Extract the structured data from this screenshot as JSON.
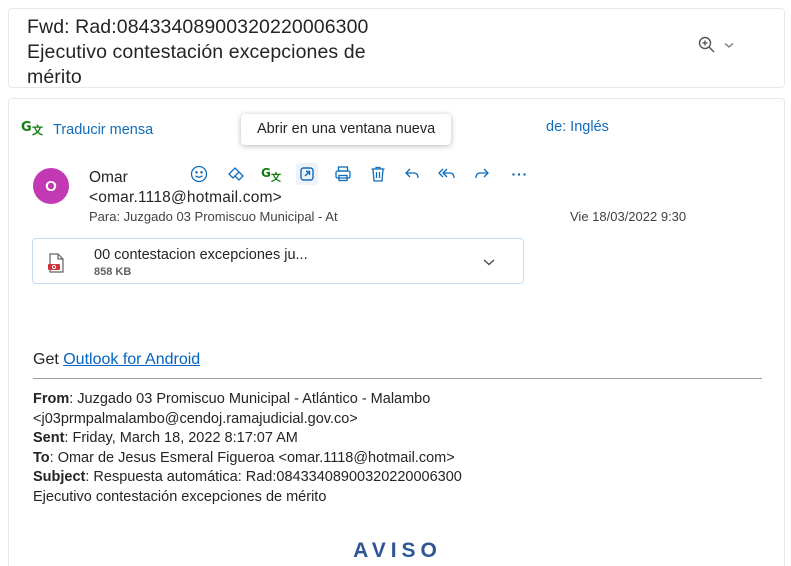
{
  "subject": {
    "lines": [
      "Fwd: Rad:08433408900320220006300",
      "Ejecutivo contestación excepciones de",
      "mérito"
    ]
  },
  "zoom": {
    "icon": "zoom-in-icon",
    "chevron": "chevron-down-icon"
  },
  "translate": {
    "icon": "translate-icon",
    "label": "Traducir mensa",
    "tail": "de: Inglés"
  },
  "tooltip": "Abrir en una ventana nueva",
  "sender": {
    "initial": "O",
    "avatar_color": "#c239b3",
    "name": "Omar",
    "email": "<omar.1118@hotmail.com>",
    "to": "Para:  Juzgado 03 Promiscuo Municipal - At",
    "date": "Vie 18/03/2022 9:30"
  },
  "toolbar": [
    {
      "name": "emoji-icon",
      "label": "Reaccionar"
    },
    {
      "name": "immersive-reader-icon",
      "label": "Lector inmersivo"
    },
    {
      "name": "translate-icon",
      "label": "Traducir"
    },
    {
      "name": "open-new-window-icon",
      "label": "Abrir en una ventana nueva"
    },
    {
      "name": "print-icon",
      "label": "Imprimir"
    },
    {
      "name": "delete-icon",
      "label": "Eliminar"
    },
    {
      "name": "reply-icon",
      "label": "Responder"
    },
    {
      "name": "reply-all-icon",
      "label": "Responder a todos"
    },
    {
      "name": "forward-icon",
      "label": "Reenviar"
    },
    {
      "name": "more-icon",
      "label": "Más acciones"
    }
  ],
  "attachment": {
    "icon": "pdf-file-icon",
    "name": "00 contestacion excepciones ju...",
    "size": "858 KB"
  },
  "body": {
    "get_prefix": "Get ",
    "get_link": "Outlook for Android",
    "from_label": "From",
    "from_value": ": Juzgado 03 Promiscuo Municipal - Atlántico - Malambo",
    "from_email": "<j03prmpalmalambo@cendoj.ramajudicial.gov.co>",
    "sent_label": "Sent",
    "sent_value": ": Friday, March 18, 2022 8:17:07 AM",
    "to_label": "To",
    "to_value": ": Omar de Jesus Esmeral Figueroa <omar.1118@hotmail.com>",
    "subject_label": "Subject",
    "subject_value": ": Respuesta automática: Rad:08433408900320220006300",
    "subject_cont": "Ejecutivo contestación excepciones de mérito",
    "aviso": "AVISO"
  },
  "colors": {
    "accent": "#0f6cbd",
    "link": "#0563c1",
    "aviso": "#2f5597"
  }
}
